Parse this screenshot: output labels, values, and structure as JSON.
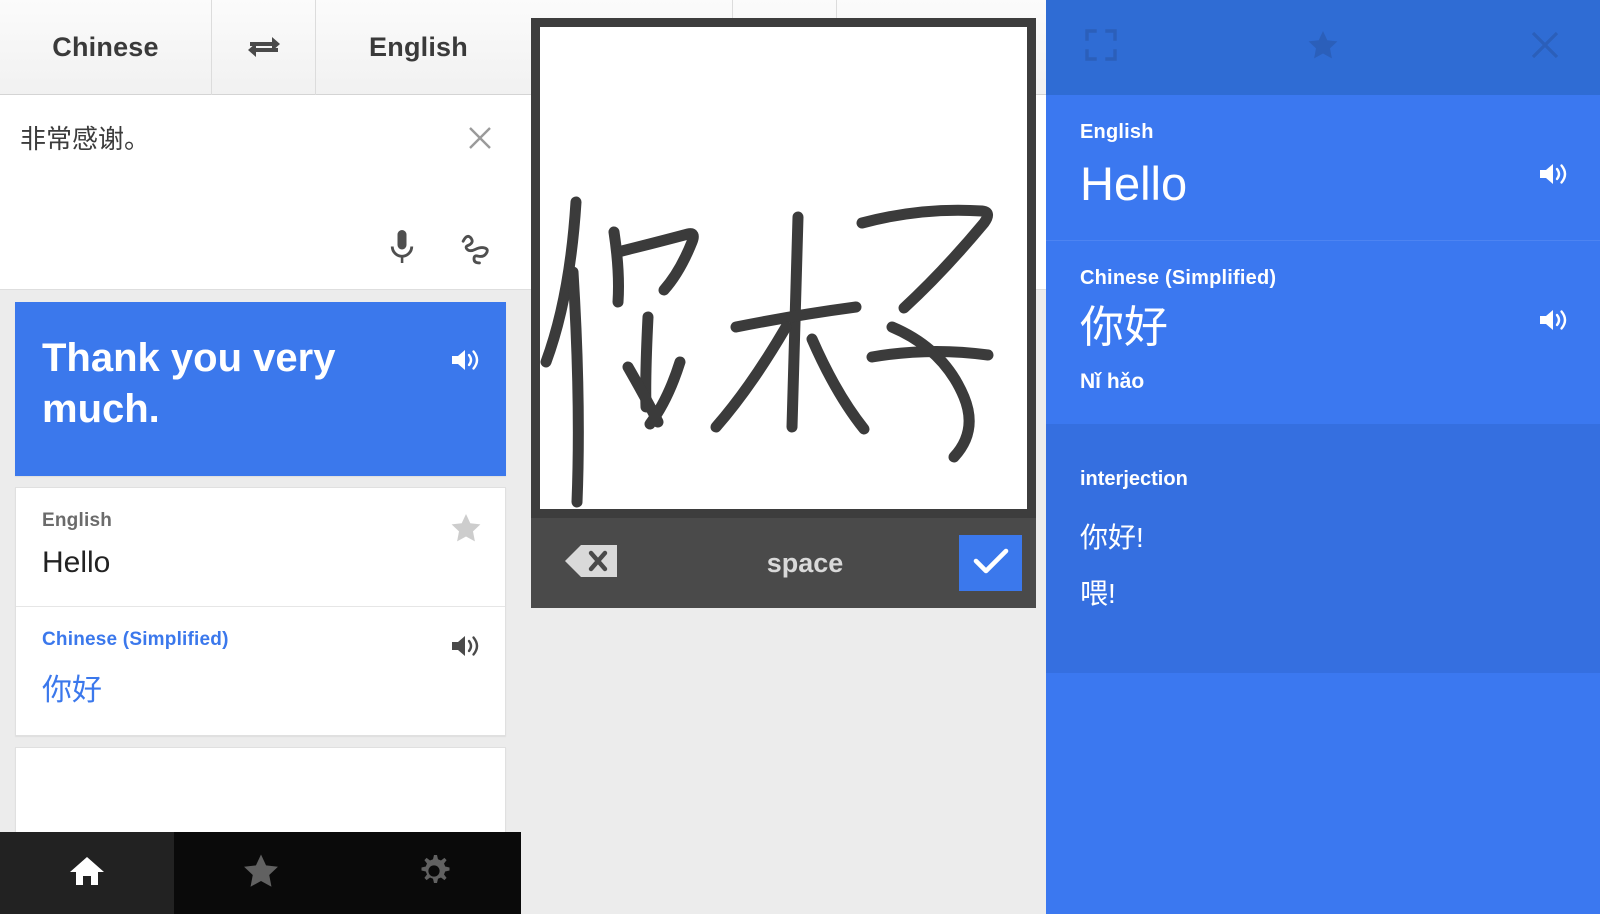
{
  "panel_left": {
    "language_bar": {
      "from_label": "Chinese",
      "swap_icon": "swap-horizontal-icon",
      "to_label": "English"
    },
    "source": {
      "text": "非常感谢。",
      "clear_icon": "close-icon",
      "mic_icon": "microphone-icon",
      "handwrite_icon": "handwriting-icon"
    },
    "primary_result": {
      "text": "Thank you very much.",
      "speaker_icon": "volume-icon"
    },
    "history": [
      {
        "lang": "English",
        "word": "Hello",
        "action_icon": "star-icon",
        "accent": false
      },
      {
        "lang": "Chinese (Simplified)",
        "word": "你好",
        "action_icon": "volume-icon",
        "accent": true
      }
    ],
    "bottom_nav": [
      {
        "name": "home",
        "icon": "home-icon",
        "active": true
      },
      {
        "name": "starred",
        "icon": "star-icon",
        "active": false
      },
      {
        "name": "settings",
        "icon": "gear-icon",
        "active": false
      }
    ]
  },
  "panel_middle": {
    "language_bar": {
      "from_label": "Chinese",
      "swap_icon": "swap-horizontal-icon",
      "to_label": "English"
    },
    "source": {
      "text": "你好",
      "clear_icon": "close-icon",
      "mic_icon": "microphone-icon",
      "handwrite_icon": "handwriting-icon"
    },
    "handwriting": {
      "drawn_text": "你好"
    },
    "keyboard": {
      "backspace_icon": "backspace-icon",
      "space_label": "space",
      "enter_icon": "check-icon"
    }
  },
  "panel_right": {
    "header": {
      "crop_icon": "fullscreen-crop-icon",
      "star_icon": "star-icon",
      "close_icon": "close-icon"
    },
    "source": {
      "lang": "English",
      "word": "Hello",
      "speaker_icon": "volume-icon"
    },
    "target": {
      "lang": "Chinese (Simplified)",
      "word": "你好",
      "romanization": "Nǐ hǎo",
      "speaker_icon": "volume-icon"
    },
    "definitions": {
      "part_of_speech": "interjection",
      "entries": [
        "你好!",
        "喂!"
      ]
    }
  },
  "colors": {
    "accent_blue": "#3b78ec",
    "panel_blue": "#3b78f0",
    "header_blue": "#2f6cd4",
    "definition_blue": "#356fe0",
    "dark_frame": "#3d3d3d",
    "keybar_gray": "#4a4a4a",
    "nav_black": "#0a0a0a"
  }
}
